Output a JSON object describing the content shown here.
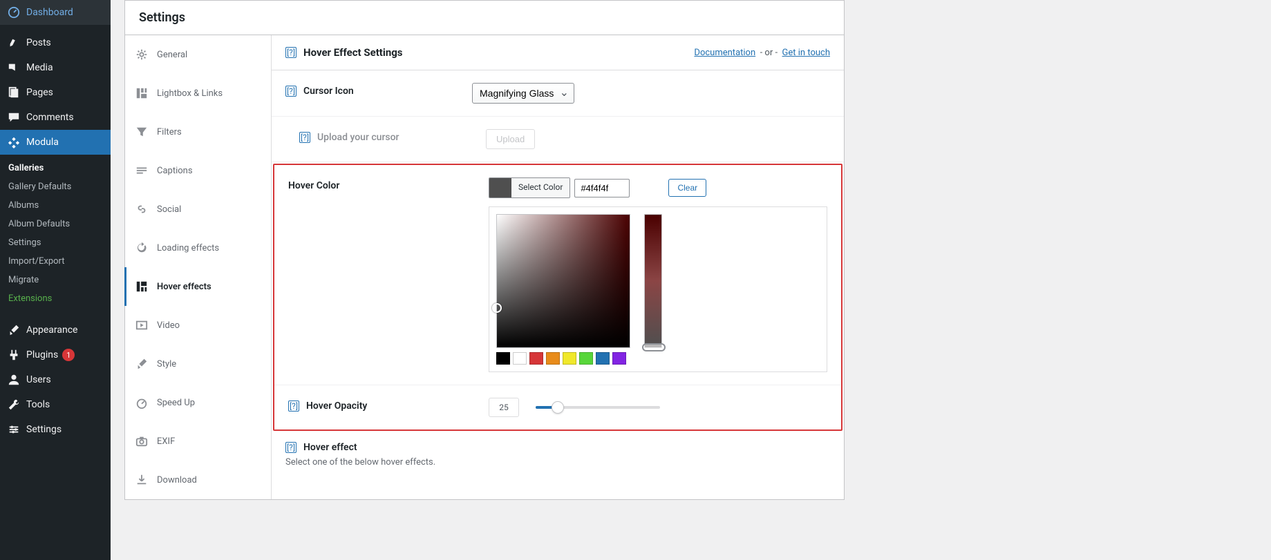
{
  "wp_sidebar": {
    "items": [
      {
        "label": "Dashboard",
        "icon": "dashboard"
      },
      {
        "label": "Posts",
        "icon": "pin"
      },
      {
        "label": "Media",
        "icon": "media"
      },
      {
        "label": "Pages",
        "icon": "page"
      },
      {
        "label": "Comments",
        "icon": "comment"
      },
      {
        "label": "Modula",
        "icon": "modula",
        "active": true
      },
      {
        "label": "Appearance",
        "icon": "brush"
      },
      {
        "label": "Plugins",
        "icon": "plug",
        "badge": "1"
      },
      {
        "label": "Users",
        "icon": "user"
      },
      {
        "label": "Tools",
        "icon": "wrench"
      },
      {
        "label": "Settings",
        "icon": "gear"
      }
    ],
    "submenu": [
      {
        "label": "Galleries",
        "current": true
      },
      {
        "label": "Gallery Defaults"
      },
      {
        "label": "Albums"
      },
      {
        "label": "Album Defaults"
      },
      {
        "label": "Settings"
      },
      {
        "label": "Import/Export"
      },
      {
        "label": "Migrate"
      },
      {
        "label": "Extensions",
        "ext": true
      }
    ]
  },
  "panel": {
    "title": "Settings",
    "tabs": [
      {
        "label": "General",
        "icon": "gear"
      },
      {
        "label": "Lightbox & Links",
        "icon": "grid"
      },
      {
        "label": "Filters",
        "icon": "filter"
      },
      {
        "label": "Captions",
        "icon": "caption"
      },
      {
        "label": "Social",
        "icon": "link"
      },
      {
        "label": "Loading effects",
        "icon": "reload"
      },
      {
        "label": "Hover effects",
        "icon": "hover",
        "active": true
      },
      {
        "label": "Video",
        "icon": "video"
      },
      {
        "label": "Style",
        "icon": "brush"
      },
      {
        "label": "Speed Up",
        "icon": "speed"
      },
      {
        "label": "EXIF",
        "icon": "camera"
      },
      {
        "label": "Download",
        "icon": "download"
      }
    ]
  },
  "section": {
    "title": "Hover Effect Settings",
    "links": {
      "doc": "Documentation",
      "or": "- or -",
      "contact": "Get in touch"
    }
  },
  "cursor": {
    "label": "Cursor Icon",
    "value": "Magnifying Glass",
    "upload_label": "Upload your cursor",
    "upload_btn": "Upload"
  },
  "hover_color": {
    "label": "Hover Color",
    "select_btn": "Select Color",
    "hex": "#4f4f4f",
    "clear_btn": "Clear",
    "swatches": [
      "#000000",
      "#ffffff",
      "#d63638",
      "#e88b1a",
      "#f0e82b",
      "#58d63a",
      "#2271b1",
      "#8224e3"
    ]
  },
  "hover_opacity": {
    "label": "Hover Opacity",
    "value": "25"
  },
  "hover_effect": {
    "label": "Hover effect",
    "desc": "Select one of the below hover effects."
  },
  "help_glyph": "[?]"
}
